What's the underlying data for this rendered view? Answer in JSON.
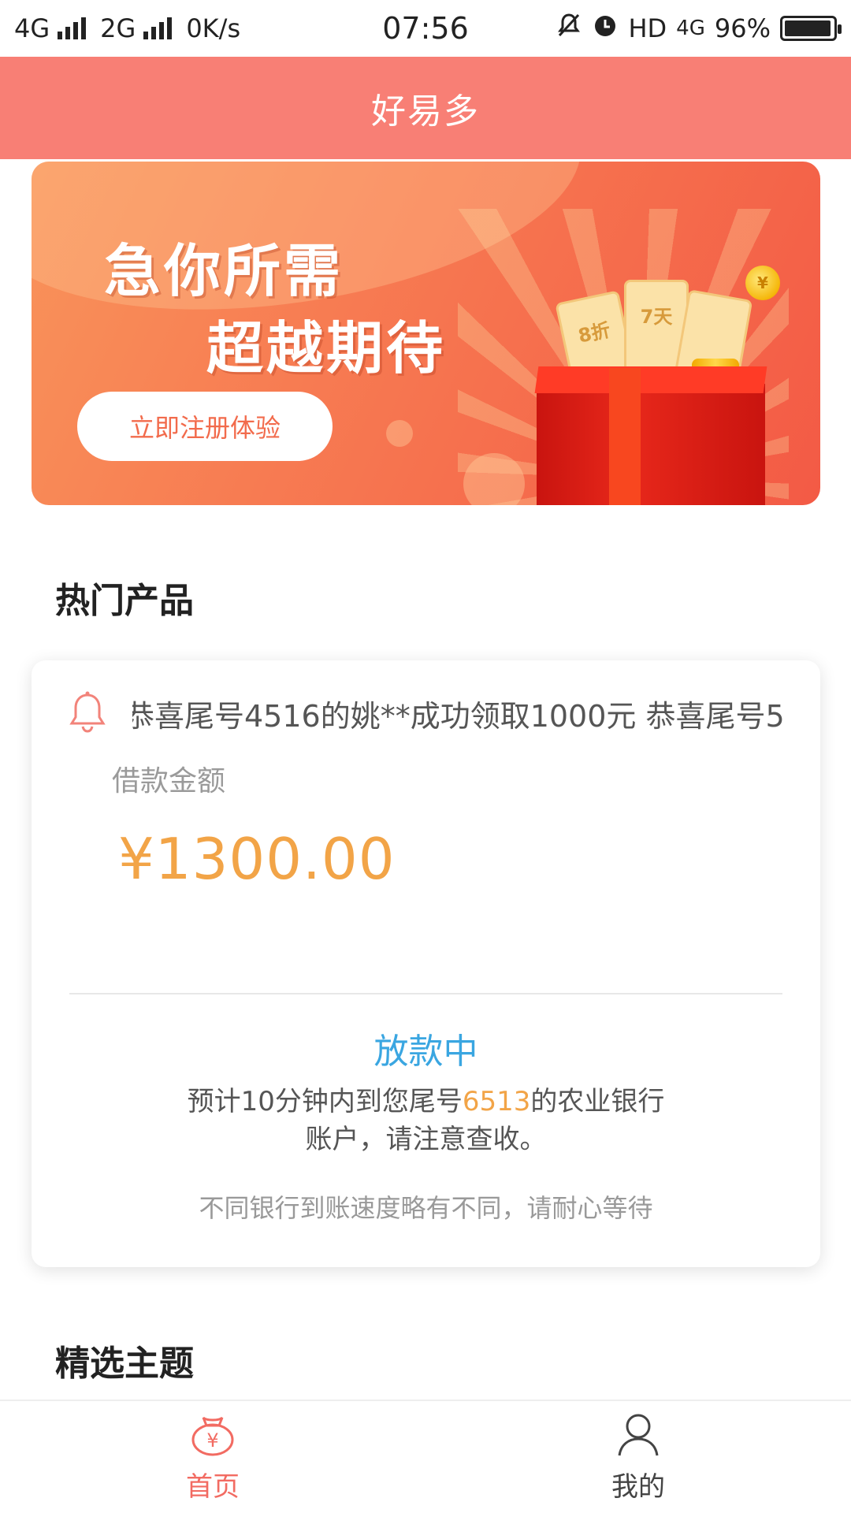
{
  "status_bar": {
    "network_left": "4G",
    "network_mid": "2G",
    "speed": "0K/s",
    "time": "07:56",
    "hd": "HD",
    "network_right": "4G",
    "battery": "96%",
    "battery_level": 0.96
  },
  "header": {
    "title": "好易多"
  },
  "banner": {
    "line1": "急你所需",
    "line2": "超越期待",
    "button": "立即注册体验",
    "ticket1": "8折",
    "ticket2": "7天",
    "coin_symbol": "¥"
  },
  "sections": {
    "hot_products": "热门产品",
    "featured_topics": "精选主题"
  },
  "loan_card": {
    "marquee": "恭喜尾号4516的姚**成功领取1000元 恭喜尾号5",
    "amount_label": "借款金额",
    "amount": "¥1300.00",
    "status": "放款中",
    "notice_prefix": "预计10分钟内到您尾号",
    "account_tail": "6513",
    "notice_suffix": "的农业银行",
    "notice_line2": "账户，请注意查收。",
    "tip": "不同银行到账速度略有不同，请耐心等待"
  },
  "nav": {
    "home": "首页",
    "mine": "我的",
    "active_color": "#f26b62"
  },
  "colors": {
    "header_bg": "#f87f75",
    "amount": "#f2a447",
    "status": "#3aa6e1"
  }
}
